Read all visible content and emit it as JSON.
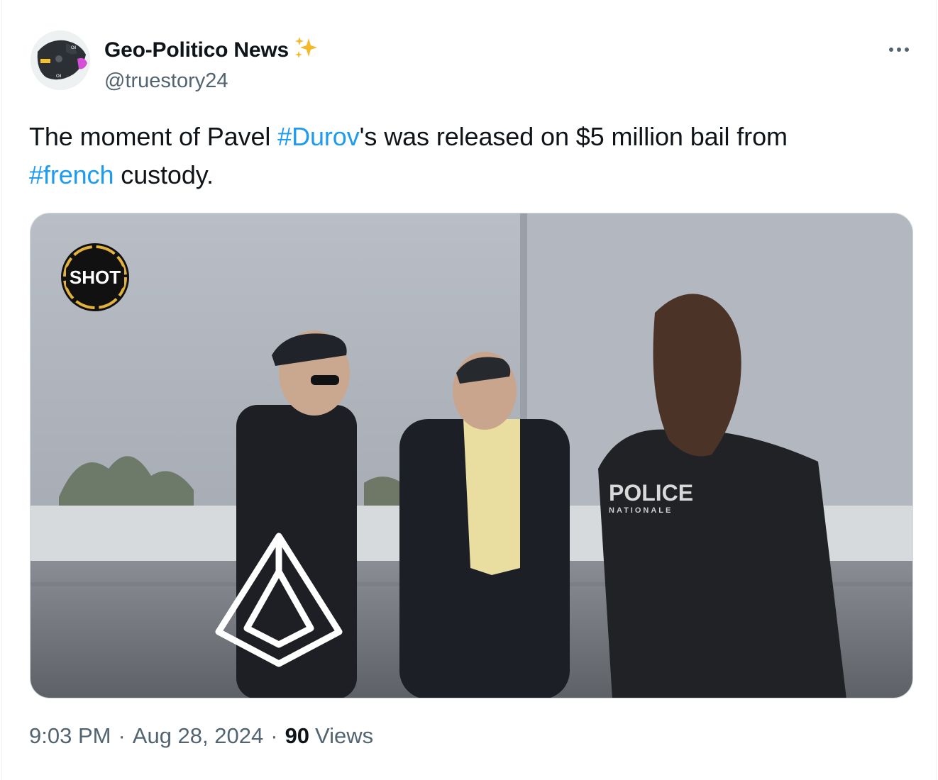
{
  "author": {
    "display_name": "Geo-Politico News",
    "verified_emoji": "✨",
    "handle": "@truestory24",
    "avatar_labels": [
      "Oil",
      "Oil"
    ]
  },
  "tweet": {
    "segments": [
      {
        "text": "The moment of Pavel ",
        "type": "text"
      },
      {
        "text": "#Durov",
        "type": "hashtag"
      },
      {
        "text": "'s was released on $5 million bail from ",
        "type": "text"
      },
      {
        "text": "#french",
        "type": "hashtag"
      },
      {
        "text": " custody.",
        "type": "text"
      }
    ]
  },
  "media": {
    "watermark_label": "SHOT",
    "vest_text": "POLICE",
    "vest_subtext": "NATIONALE"
  },
  "meta": {
    "time": "9:03 PM",
    "separator": "·",
    "date": "Aug 28, 2024",
    "views_count": "90",
    "views_label": "Views"
  },
  "colors": {
    "link": "#1d9bf0",
    "secondary_text": "#536471",
    "primary_text": "#0f1419"
  }
}
